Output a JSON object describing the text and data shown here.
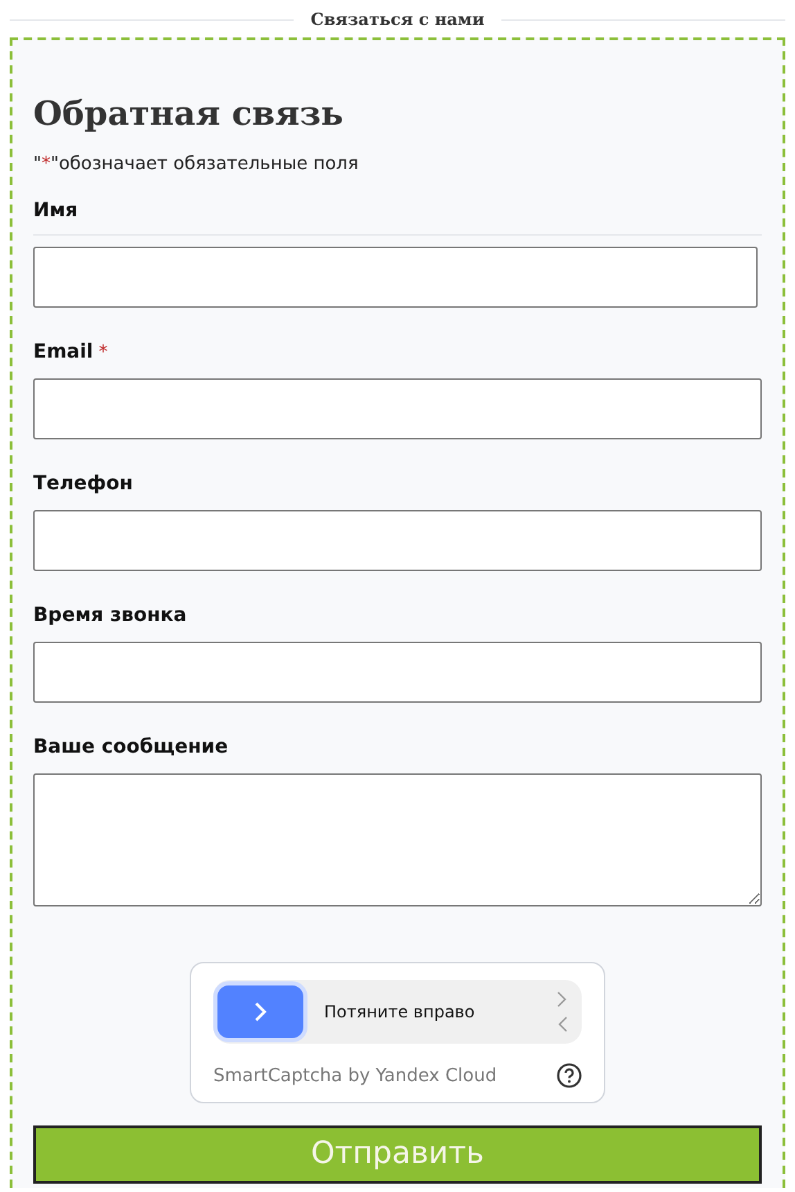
{
  "section_title": "Связаться с нами",
  "form": {
    "title": "Обратная связь",
    "required_note": {
      "before": "\"",
      "mark": "*",
      "after": "\"обозначает обязательные поля"
    },
    "fields": [
      {
        "label": "Имя",
        "kind": "input"
      },
      {
        "label": "Email",
        "required_mark": "*",
        "kind": "input"
      },
      {
        "label": "Телефон",
        "kind": "input"
      },
      {
        "label": "Время звонка",
        "kind": "input"
      },
      {
        "label": "Ваше сообщение",
        "kind": "textarea"
      }
    ],
    "captcha": {
      "slider_label": "Потяните вправо",
      "brand": "SmartCaptcha by Yandex Cloud"
    },
    "submit": "Отправить"
  }
}
